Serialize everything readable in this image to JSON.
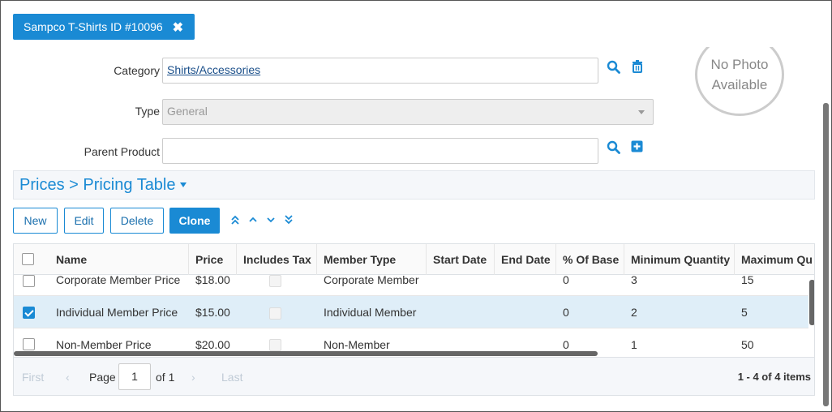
{
  "tab": {
    "title": "Sampco T-Shirts ID #10096",
    "close_icon": "close-icon"
  },
  "form": {
    "category": {
      "label": "Category",
      "value": "Shirts/Accessories"
    },
    "type": {
      "label": "Type",
      "value": "General"
    },
    "parent_product": {
      "label": "Parent Product",
      "value": ""
    }
  },
  "photo": {
    "line1": "No Photo",
    "line2": "Available"
  },
  "section": {
    "breadcrumb": "Prices > Pricing Table"
  },
  "toolbar": {
    "new": "New",
    "edit": "Edit",
    "delete": "Delete",
    "clone": "Clone"
  },
  "grid": {
    "columns": [
      "Name",
      "Price",
      "Includes Tax",
      "Member Type",
      "Start Date",
      "End Date",
      "% Of Base",
      "Minimum Quantity",
      "Maximum Qu"
    ],
    "rows": [
      {
        "name": "Corporate Member Price",
        "price": "$18.00",
        "member_type": "Corporate Member",
        "start": "",
        "end": "",
        "pct": "0",
        "min": "3",
        "max": "15",
        "checked": false
      },
      {
        "name": "Individual Member Price",
        "price": "$15.00",
        "member_type": "Individual Member",
        "start": "",
        "end": "",
        "pct": "0",
        "min": "2",
        "max": "5",
        "checked": true
      },
      {
        "name": "Non-Member Price",
        "price": "$20.00",
        "member_type": "Non-Member",
        "start": "",
        "end": "",
        "pct": "0",
        "min": "1",
        "max": "50",
        "checked": false
      }
    ]
  },
  "pager": {
    "first": "First",
    "last": "Last",
    "page_label": "Page",
    "page": "1",
    "of": "of 1",
    "summary": "1 - 4 of 4 items"
  },
  "colors": {
    "accent": "#1a8ad4",
    "selected_row": "#dfeef8"
  }
}
